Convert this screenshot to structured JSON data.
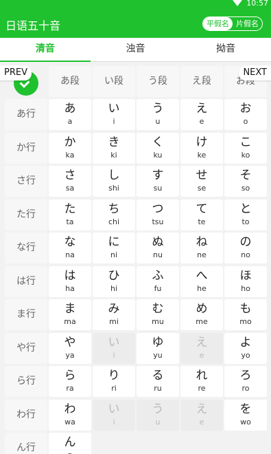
{
  "status": {
    "time": "10:57"
  },
  "appbar": {
    "title": "日语五十音",
    "toggle": {
      "options": [
        "平假名",
        "片假名"
      ],
      "selected": 0
    }
  },
  "tabs": [
    {
      "label": "清音",
      "active": true
    },
    {
      "label": "浊音",
      "active": false
    },
    {
      "label": "拗音",
      "active": false
    }
  ],
  "nav": {
    "prev": "PREV",
    "next": "NEXT"
  },
  "columns": [
    "あ段",
    "い段",
    "う段",
    "え段",
    "お段"
  ],
  "rows": [
    {
      "label": "あ行",
      "cells": [
        [
          "あ",
          "a"
        ],
        [
          "い",
          "i"
        ],
        [
          "う",
          "u"
        ],
        [
          "え",
          "e"
        ],
        [
          "お",
          "o"
        ]
      ]
    },
    {
      "label": "か行",
      "cells": [
        [
          "か",
          "ka"
        ],
        [
          "き",
          "ki"
        ],
        [
          "く",
          "ku"
        ],
        [
          "け",
          "ke"
        ],
        [
          "こ",
          "ko"
        ]
      ]
    },
    {
      "label": "さ行",
      "cells": [
        [
          "さ",
          "sa"
        ],
        [
          "し",
          "shi"
        ],
        [
          "す",
          "su"
        ],
        [
          "せ",
          "se"
        ],
        [
          "そ",
          "so"
        ]
      ]
    },
    {
      "label": "た行",
      "cells": [
        [
          "た",
          "ta"
        ],
        [
          "ち",
          "chi"
        ],
        [
          "つ",
          "tsu"
        ],
        [
          "て",
          "te"
        ],
        [
          "と",
          "to"
        ]
      ]
    },
    {
      "label": "な行",
      "cells": [
        [
          "な",
          "na"
        ],
        [
          "に",
          "ni"
        ],
        [
          "ぬ",
          "nu"
        ],
        [
          "ね",
          "ne"
        ],
        [
          "の",
          "no"
        ]
      ]
    },
    {
      "label": "は行",
      "cells": [
        [
          "は",
          "ha"
        ],
        [
          "ひ",
          "hi"
        ],
        [
          "ふ",
          "fu"
        ],
        [
          "へ",
          "he"
        ],
        [
          "ほ",
          "ho"
        ]
      ]
    },
    {
      "label": "ま行",
      "cells": [
        [
          "ま",
          "ma"
        ],
        [
          "み",
          "mi"
        ],
        [
          "む",
          "mu"
        ],
        [
          "め",
          "me"
        ],
        [
          "も",
          "mo"
        ]
      ]
    },
    {
      "label": "や行",
      "cells": [
        [
          "や",
          "ya"
        ],
        [
          "い",
          "i",
          true
        ],
        [
          "ゆ",
          "yu"
        ],
        [
          "え",
          "e",
          true
        ],
        [
          "よ",
          "yo"
        ]
      ]
    },
    {
      "label": "ら行",
      "cells": [
        [
          "ら",
          "ra"
        ],
        [
          "り",
          "ri"
        ],
        [
          "る",
          "ru"
        ],
        [
          "れ",
          "re"
        ],
        [
          "ろ",
          "ro"
        ]
      ]
    },
    {
      "label": "わ行",
      "cells": [
        [
          "わ",
          "wa"
        ],
        [
          "い",
          "i",
          true
        ],
        [
          "う",
          "u",
          true
        ],
        [
          "え",
          "e",
          true
        ],
        [
          "を",
          "wo"
        ]
      ]
    },
    {
      "label": "ん行",
      "cells": [
        [
          "ん",
          "n"
        ]
      ]
    }
  ],
  "colors": {
    "accent": "#1fc12e"
  }
}
